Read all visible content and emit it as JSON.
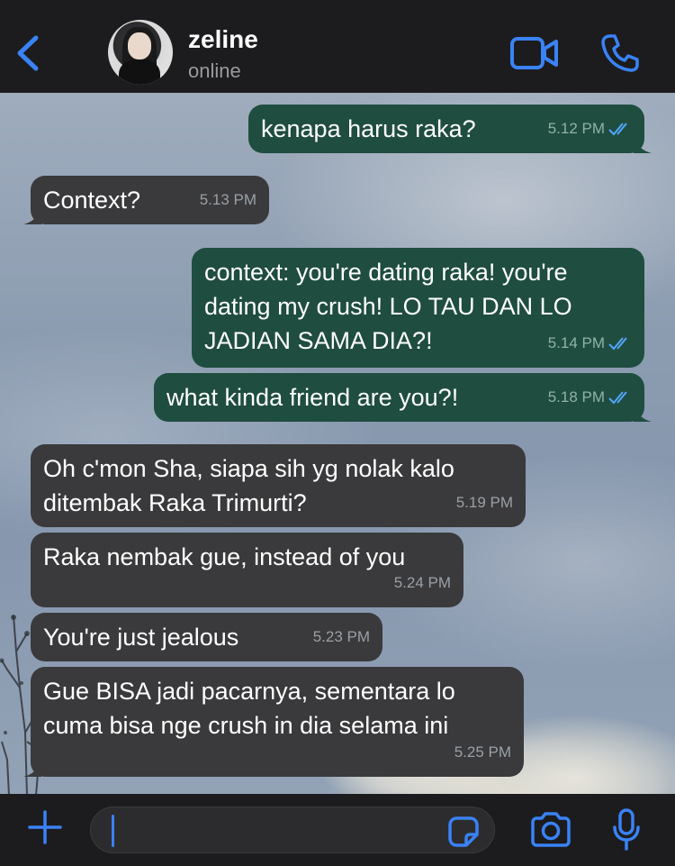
{
  "header": {
    "contact_name": "zeline",
    "contact_status": "online",
    "back_icon": "chevron-left-icon",
    "video_icon": "video-camera-icon",
    "call_icon": "phone-icon",
    "accent_color": "#3a82f7"
  },
  "messages": [
    {
      "direction": "out",
      "text": "kenapa harus raka?",
      "time": "5.12 PM",
      "read": true
    },
    {
      "direction": "in",
      "text": "Context?",
      "time": "5.13 PM"
    },
    {
      "direction": "out",
      "text": "context: you're dating raka! you're dating my crush! LO TAU DAN LO JADIAN SAMA DIA?!",
      "time": "5.14 PM",
      "read": true
    },
    {
      "direction": "out",
      "text": "what kinda friend are you?!",
      "time": "5.18 PM",
      "read": true
    },
    {
      "direction": "in",
      "text": "Oh c'mon Sha, siapa sih yg nolak kalo ditembak Raka Trimurti?",
      "time": "5.19 PM"
    },
    {
      "direction": "in",
      "text": "Raka nembak gue, instead of you",
      "time": "5.24 PM"
    },
    {
      "direction": "in",
      "text": "You're just jealous",
      "time": "5.23 PM"
    },
    {
      "direction": "in",
      "text": "Gue BISA jadi pacarnya, sementara lo cuma bisa nge crush in dia selama ini",
      "time": "5.25 PM"
    }
  ],
  "colors": {
    "outgoing_bubble": "#1f4d3f",
    "incoming_bubble": "#3a3a3c",
    "read_ticks": "#53a6ff"
  },
  "input_bar": {
    "plus_icon": "plus-icon",
    "message_value": "",
    "sticker_icon": "sticker-icon",
    "camera_icon": "camera-icon",
    "mic_icon": "microphone-icon"
  }
}
